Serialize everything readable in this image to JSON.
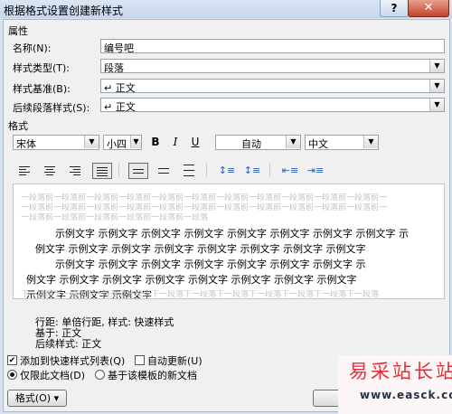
{
  "window": {
    "title": "根据格式设置创建新样式",
    "help_glyph": "?",
    "close_glyph": "✕"
  },
  "properties": {
    "section_label": "属性",
    "name_label": "名称(N):",
    "name_value": "编号吧",
    "type_label": "样式类型(T):",
    "type_value": "段落",
    "base_label": "样式基准(B):",
    "base_value": "↵ 正文",
    "next_label": "后续段落样式(S):",
    "next_value": "↵ 正文"
  },
  "format": {
    "section_label": "格式",
    "font_value": "宋体",
    "size_value": "小四",
    "bold_glyph": "B",
    "italic_glyph": "I",
    "underline_glyph": "U",
    "color_value": "自动",
    "lang_value": "中文"
  },
  "preview": {
    "prev_paragraph": [
      "一段落前一段落前一段落前一段落前一段落前一段落前一段落前一段落前一段落前一段落前一段落前一",
      "一段落前一段落前一段落前一段落前一段落前一段落前一段落前一段落前一段落前一段落前一段落前一",
      "一段落前一段落前一段落前一段落前一段落前一段落"
    ],
    "sample_lines": [
      "示例文字  示例文字  示例文字  示例文字  示例文字  示例文字  示例文字  示例文字  示",
      "例文字  示例文字  示例文字  示例文字  示例文字  示例文字  示例文字  示例文字",
      "示例文字  示例文字  示例文字  示例文字  示例文字  示例文字  示例文字  示",
      "例文字  示例文字  示例文字  示例文字  示例文字  示例文字  示例文字  示例文字",
      "示例文字  示例文字  示例文字"
    ],
    "next_paragraph": "下一段落下一段落下一段落下一段落下一段落下一段落下一段落下一段落下一段落下一段落下一段落"
  },
  "description": {
    "line1": "行距:  单倍行距,  样式:  快速样式",
    "line2": "基于:  正文",
    "line3": "后续样式:  正文"
  },
  "options": {
    "add_to_quick": "添加到快速样式列表(Q)",
    "add_to_quick_checked": true,
    "auto_update": "自动更新(U)",
    "auto_update_checked": false,
    "only_this_doc": "仅限此文档(D)",
    "new_docs_template": "基于该模板的新文档",
    "selected_scope": "only_this_doc"
  },
  "buttons": {
    "format": "格式(O) ▾"
  },
  "watermark": {
    "text": "易采站长站",
    "url": "www.easck.com"
  },
  "colors": {
    "title_bg": "#c5d6ec",
    "close_red": "#c7412a",
    "watermark_red": "#e1303b"
  }
}
